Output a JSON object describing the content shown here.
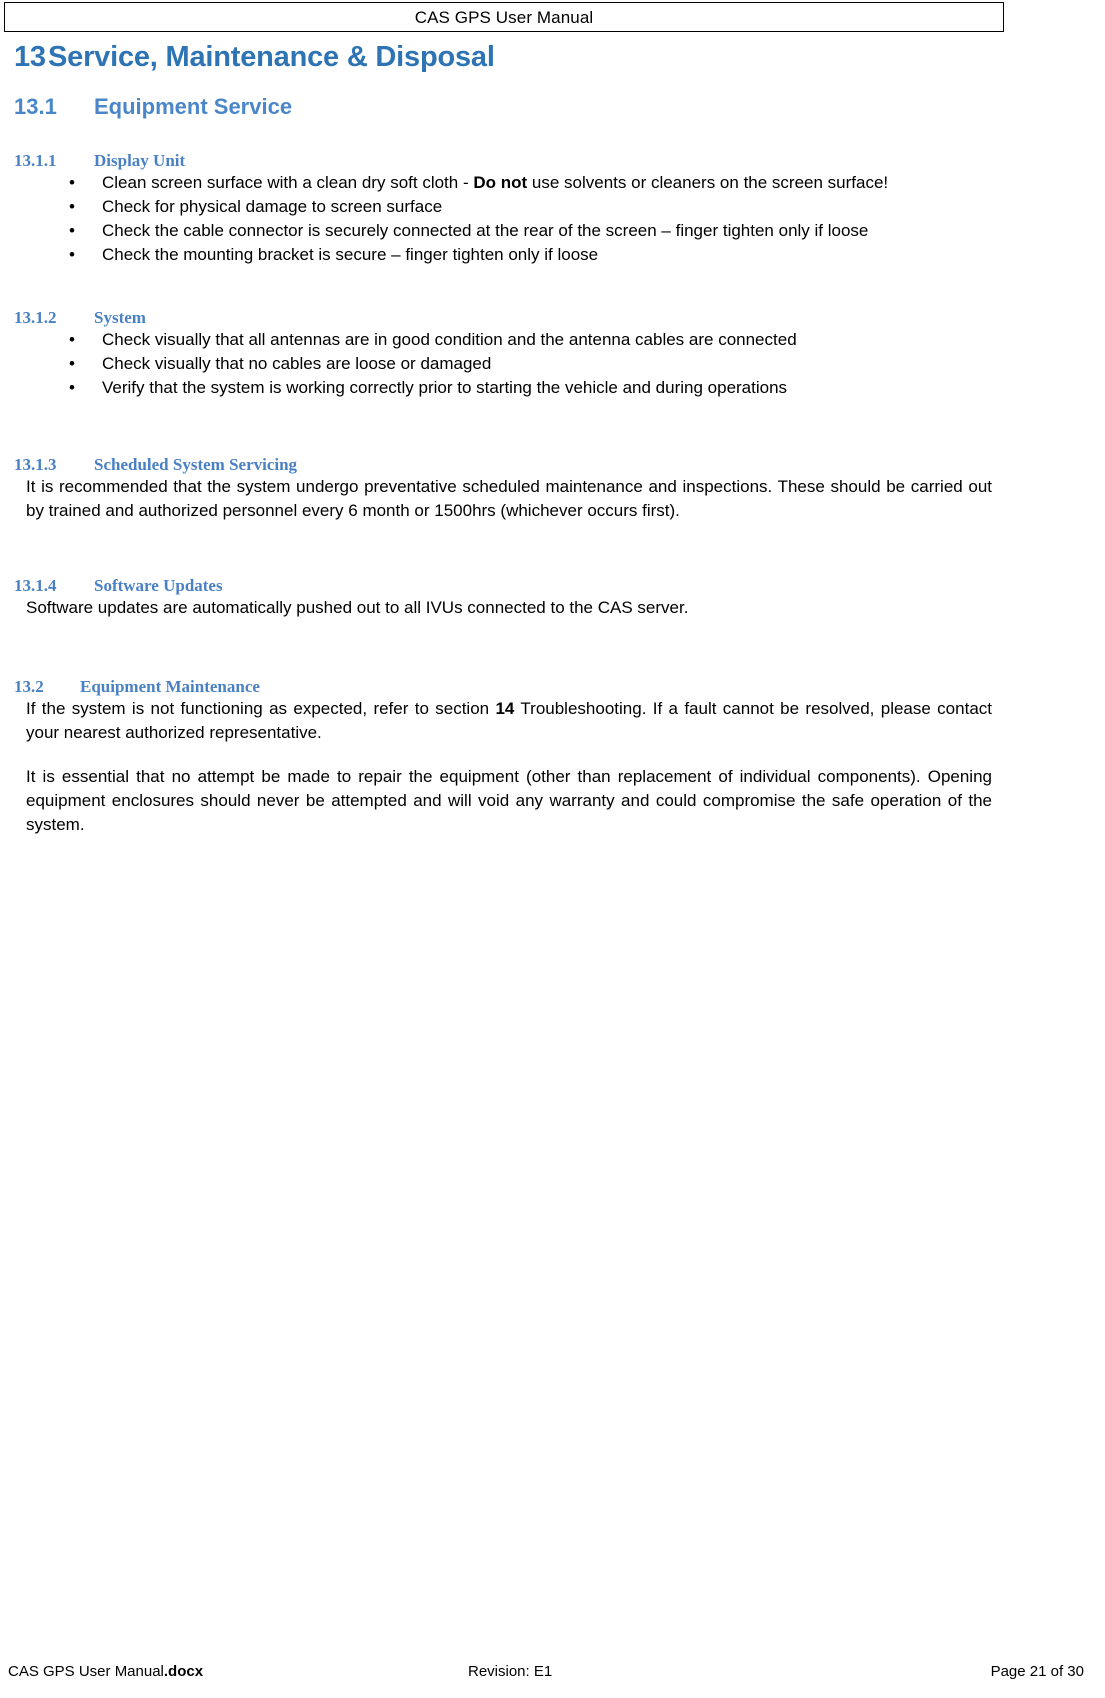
{
  "header": {
    "title": "CAS GPS User Manual"
  },
  "document": {
    "h1": {
      "number": "13",
      "title": "Service, Maintenance & Disposal"
    },
    "sections": [
      {
        "number": "13.1",
        "title": "Equipment Service",
        "level": 2,
        "subsections": [
          {
            "number": "13.1.1",
            "title": "Display Unit",
            "bullets": [
              {
                "pre": "Clean screen surface with a clean dry soft cloth - ",
                "bold": "Do not",
                "post": " use solvents or cleaners on the screen surface!"
              },
              {
                "pre": "Check for physical damage to screen surface",
                "bold": "",
                "post": ""
              },
              {
                "pre": "Check the cable connector is securely connected at the rear of the screen – finger tighten only if loose",
                "bold": "",
                "post": ""
              },
              {
                "pre": "Check the mounting bracket is secure – finger tighten only if loose",
                "bold": "",
                "post": ""
              }
            ]
          },
          {
            "number": "13.1.2",
            "title": "System",
            "bullets": [
              {
                "pre": "Check visually that all antennas are in good condition and the antenna cables are connected",
                "bold": "",
                "post": ""
              },
              {
                "pre": "Check visually that no cables are loose or damaged",
                "bold": "",
                "post": ""
              },
              {
                "pre": "Verify that the system is working correctly prior to starting the vehicle and during operations",
                "bold": "",
                "post": ""
              }
            ]
          },
          {
            "number": "13.1.3",
            "title": "Scheduled System Servicing",
            "paragraph": "It is recommended that the system undergo preventative scheduled maintenance and inspections.  These should be carried out by trained and authorized personnel every 6 month or 1500hrs (whichever occurs first)."
          },
          {
            "number": "13.1.4",
            "title": "Software Updates",
            "paragraph": "Software updates are automatically pushed out to all IVUs connected to the CAS server."
          }
        ]
      },
      {
        "number": "13.2",
        "title": "Equipment Maintenance",
        "level": 2,
        "paragraph_1": {
          "pre": "If the system is not functioning as expected, refer to section ",
          "bold": "14",
          "post": " Troubleshooting.  If a fault cannot be resolved, please contact your nearest authorized representative."
        },
        "paragraph_2": "It is essential that no attempt be made to repair the equipment (other than replacement of individual components).  Opening equipment enclosures should never be attempted and will void any warranty and could compromise the safe operation of the system."
      }
    ]
  },
  "footer": {
    "file_name": "CAS GPS User Manual",
    "file_ext": ".docx",
    "revision": "Revision: E1",
    "page": "Page 21 of 30"
  },
  "colors": {
    "heading1": "#2E74B5",
    "heading2": "#4A86C8",
    "heading3": "#4A80C4",
    "body": "#000000",
    "page_background": "#FFFFFF"
  },
  "icons": {
    "bullet": "•"
  }
}
